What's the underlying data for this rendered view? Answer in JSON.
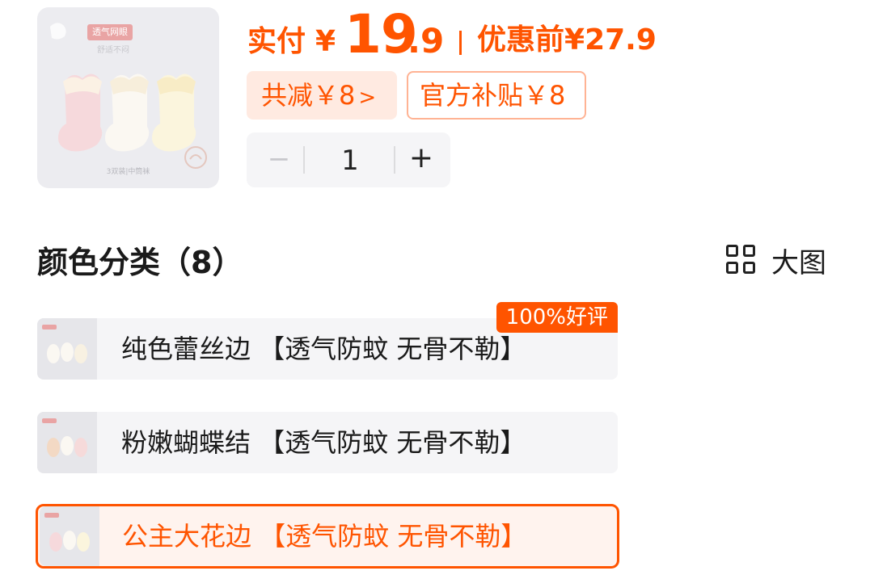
{
  "product": {
    "image_tag": "透气网眼",
    "image_tag_sub": "舒适不闷",
    "image_footer": "3双装|中筒袜"
  },
  "price": {
    "paid_label": "实付",
    "yen": "¥",
    "integer": "19",
    "decimal": ".9",
    "original_label": "优惠前",
    "original_price": "¥27.9"
  },
  "discounts": {
    "total": "共减￥8",
    "total_chevron": ">",
    "subsidy": "官方补贴￥8"
  },
  "stepper": {
    "minus": "−",
    "quantity": "1",
    "plus": "+"
  },
  "section": {
    "title": "颜色分类（8）",
    "big_view_label": "大图",
    "big_view_icon": "grid-icon"
  },
  "variants": [
    {
      "label": "纯色蕾丝边 【透气防蚊 无骨不勒】",
      "badge": "100%好评",
      "selected": false
    },
    {
      "label": "粉嫩蝴蝶结 【透气防蚊 无骨不勒】",
      "selected": false
    },
    {
      "label": "公主大花边 【透气防蚊 无骨不勒】",
      "selected": true
    }
  ],
  "colors": {
    "accent": "#ff5400",
    "badge_fill": "#ffeae1",
    "badge_border": "#ffb394",
    "surface": "#f5f5f7"
  }
}
